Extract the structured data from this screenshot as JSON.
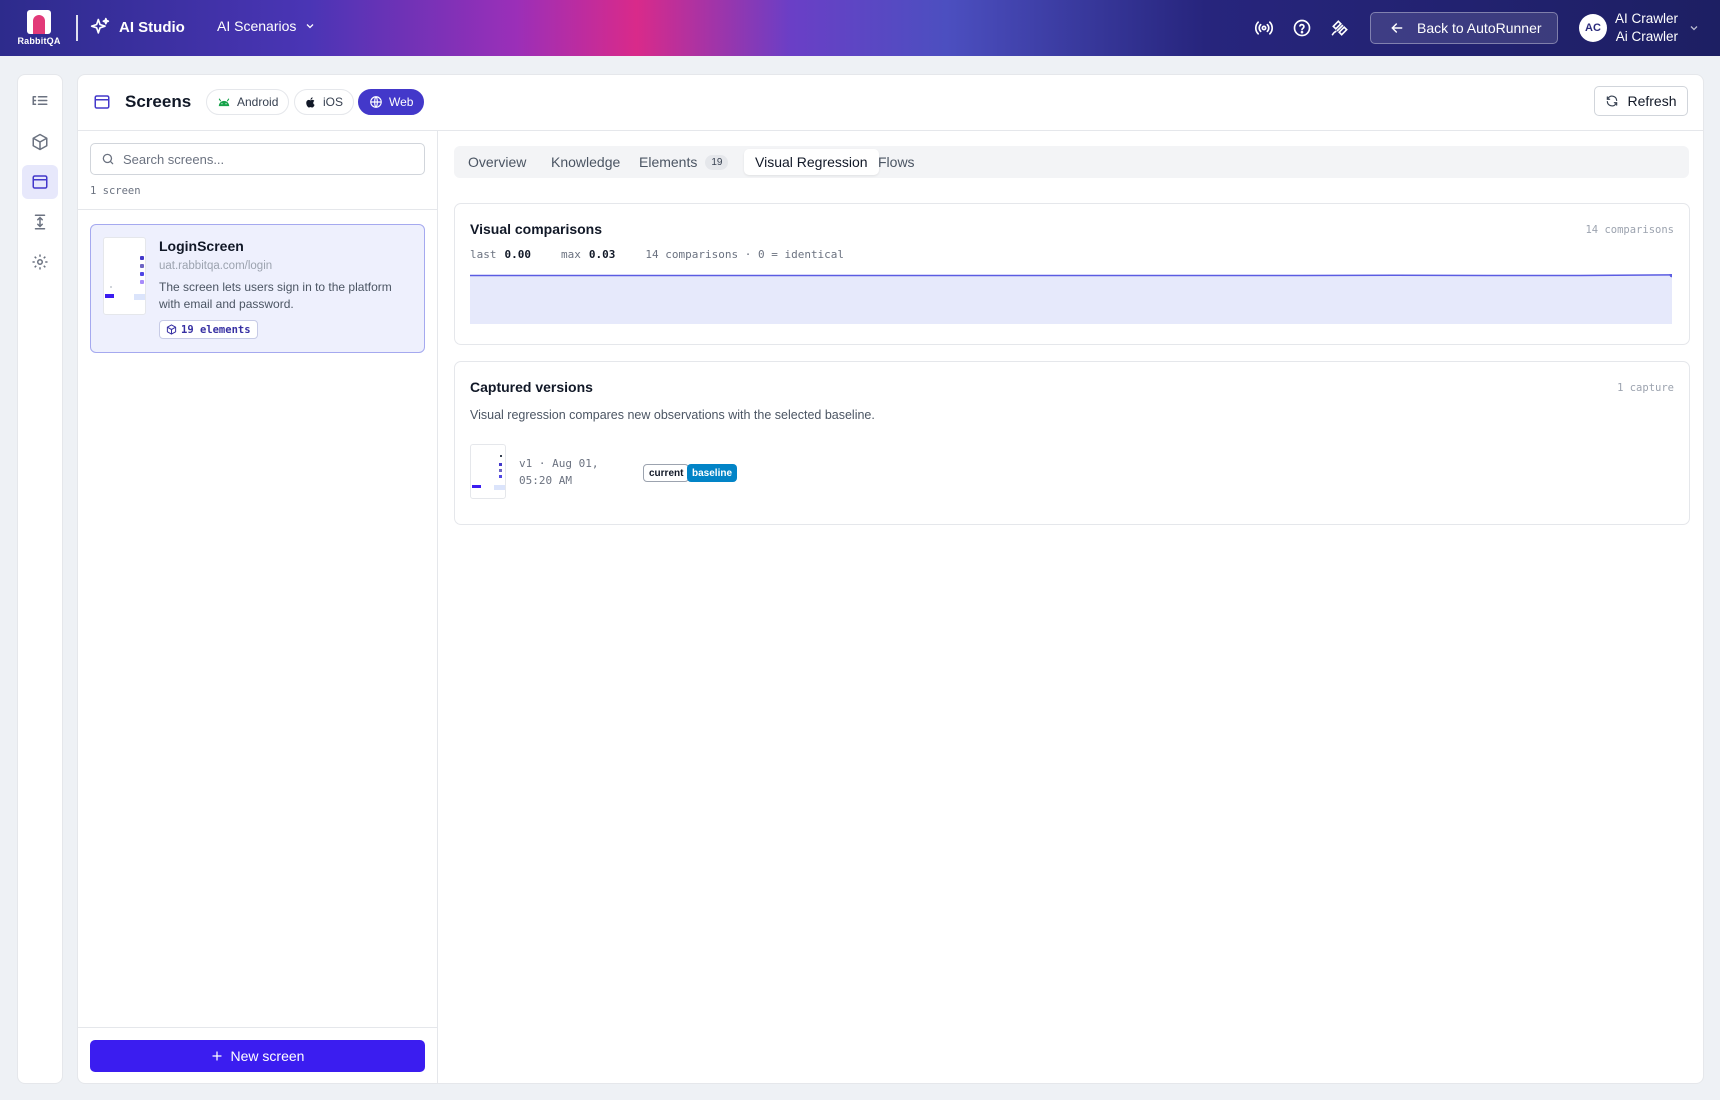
{
  "app": {
    "brand": "RabbitQA",
    "studio": "AI Studio",
    "scenarios_menu": "AI Scenarios",
    "back_button": "Back to AutoRunner",
    "user_initials": "AC",
    "user_name": "AI Crawler",
    "user_role": "Ai Crawler"
  },
  "header": {
    "title": "Screens",
    "platforms": [
      "Android",
      "iOS",
      "Web"
    ],
    "active_platform": "Web",
    "refresh": "Refresh"
  },
  "screens_list": {
    "search_placeholder": "Search screens...",
    "count_label": "1 screen",
    "items": [
      {
        "name": "LoginScreen",
        "url": "uat.rabbitqa.com/login",
        "description": "The screen lets users sign in to the platform with email and password.",
        "elements_badge": "19 elements"
      }
    ],
    "new_button": "New screen"
  },
  "tabs": {
    "items": [
      {
        "label": "Overview"
      },
      {
        "label": "Knowledge"
      },
      {
        "label": "Elements",
        "count": "19"
      },
      {
        "label": "Visual Regression"
      },
      {
        "label": "Flows"
      }
    ],
    "active": "Visual Regression"
  },
  "visual_comparisons": {
    "title": "Visual comparisons",
    "meta": "14 comparisons",
    "last_label": "last",
    "last_value": "0.00",
    "max_label": "max",
    "max_value": "0.03",
    "summary": "14 comparisons · 0 = identical",
    "chart_data": {
      "type": "area",
      "x": [
        1,
        2,
        3,
        4,
        5,
        6,
        7,
        8,
        9,
        10,
        11,
        12,
        13,
        14
      ],
      "values": [
        0.0,
        0.0,
        0.0,
        0.0,
        0.0,
        0.0,
        0.0,
        0.0,
        0.0,
        0.0,
        0.01,
        0.0,
        0.0,
        0.03
      ],
      "ylim": [
        0,
        1
      ],
      "color": "#5b5ce2"
    }
  },
  "captured_versions": {
    "title": "Captured versions",
    "meta": "1 capture",
    "description": "Visual regression compares new observations with the selected baseline.",
    "items": [
      {
        "label": "v1 · Aug 01, 05:20 AM",
        "tags": [
          "current",
          "baseline"
        ]
      }
    ]
  },
  "colors": {
    "accent": "#4338ca",
    "primary_button": "#3b1df0",
    "baseline_tag": "#0284c7"
  }
}
